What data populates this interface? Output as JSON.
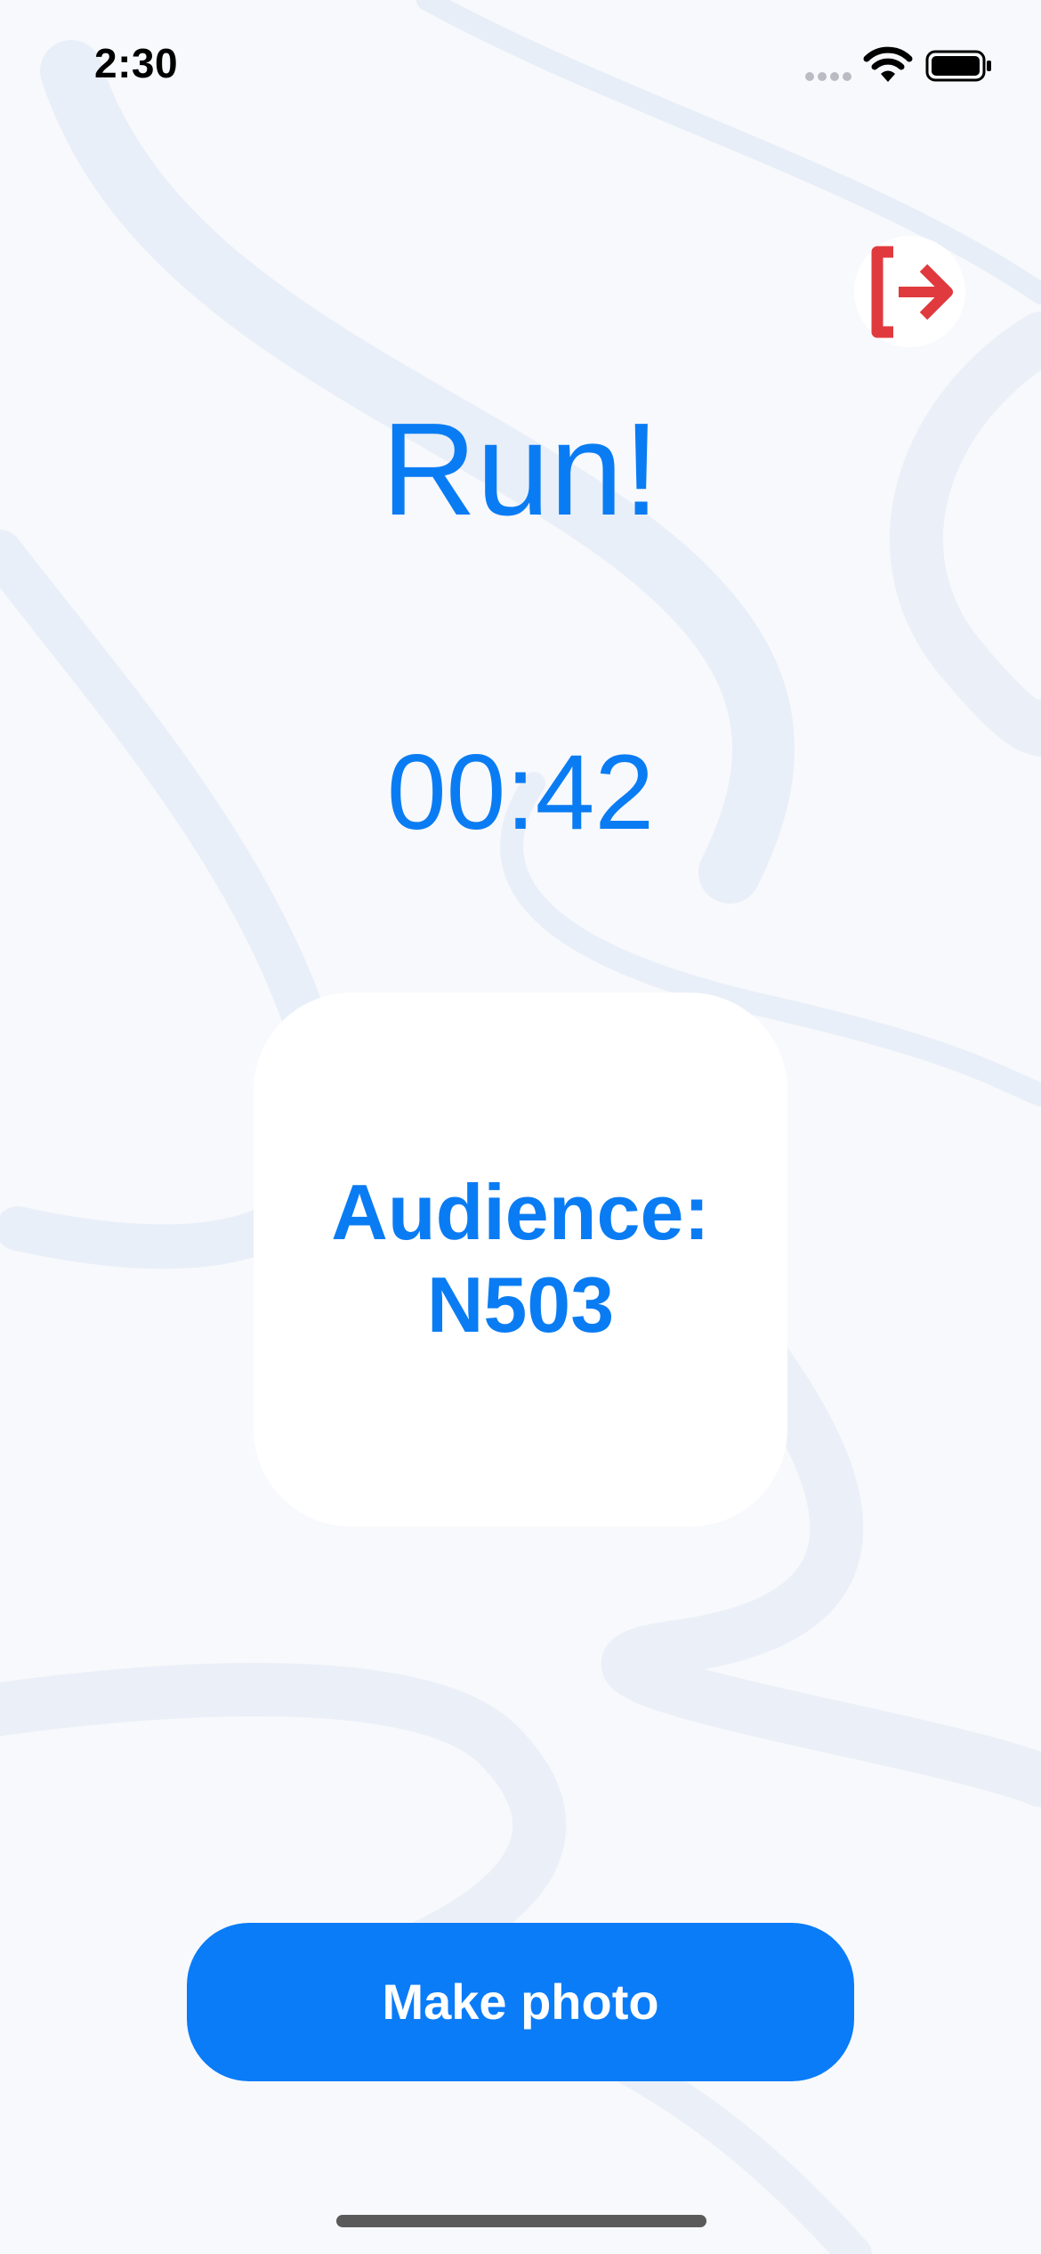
{
  "status_bar": {
    "time": "2:30"
  },
  "header": {
    "logout_icon": "logout-arrow-icon"
  },
  "main": {
    "title": "Run!",
    "timer": "00:42",
    "audience": {
      "label": "Audience:",
      "value": "N503"
    },
    "make_photo_label": "Make photo"
  },
  "colors": {
    "accent": "#0a7cf3",
    "button": "#0a7cf8",
    "logout": "#e03a3e",
    "background": "#f8f9fc"
  }
}
